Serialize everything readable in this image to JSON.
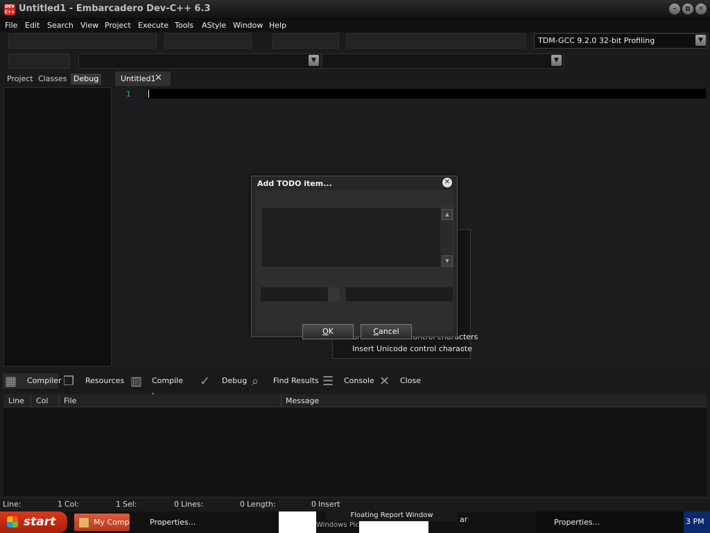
{
  "window": {
    "title": "Untitled1 - Embarcadero Dev-C++ 6.3",
    "app_icon_text": "DEV C++",
    "minimize": "–",
    "restore": "⧉",
    "close": "✕"
  },
  "menu": [
    "File",
    "Edit",
    "Search",
    "View",
    "Project",
    "Execute",
    "Tools",
    "AStyle",
    "Window",
    "Help"
  ],
  "toolbar": {
    "compiler": "TDM-GCC 9.2.0 32-bit Profiling",
    "dropdown_arrow": "▼"
  },
  "left_tabs": [
    "Project",
    "Classes",
    "Debug"
  ],
  "editor": {
    "tab_label": "Untitled1",
    "tab_close": "✕",
    "line_number": "1"
  },
  "context_menu": {
    "items": [
      "Show Unicode control characters",
      "Insert Unicode control characte"
    ],
    "submenu_arrow": "›"
  },
  "dialog": {
    "title": "Add TODO item...",
    "close": "✕",
    "ok": "OK",
    "ok_mnemonic": "O",
    "ok_rest": "K",
    "cancel_mnemonic": "C",
    "cancel_rest": "ancel",
    "scroll_up": "▲",
    "scroll_down": "▼"
  },
  "bottom_tabs": [
    "Compiler",
    "Resources",
    "Compile Log",
    "Debug",
    "Find Results",
    "Console",
    "Close"
  ],
  "message_columns": [
    "Line",
    "Col",
    "File",
    "Message"
  ],
  "status": {
    "line_label": "Line:",
    "line_val": "1",
    "col_label": "Col:",
    "col_val": "1",
    "sel_label": "Sel:",
    "sel_val": "0",
    "lines_label": "Lines:",
    "lines_val": "0",
    "length_label": "Length:",
    "length_val": "0",
    "mode": "Insert"
  },
  "taskbar": {
    "start": "start",
    "items": [
      "My Compu",
      "Properties...",
      "Floating Report Window",
      "Windows Pic",
      "ar",
      "Properties..."
    ],
    "clock": "3 PM"
  }
}
